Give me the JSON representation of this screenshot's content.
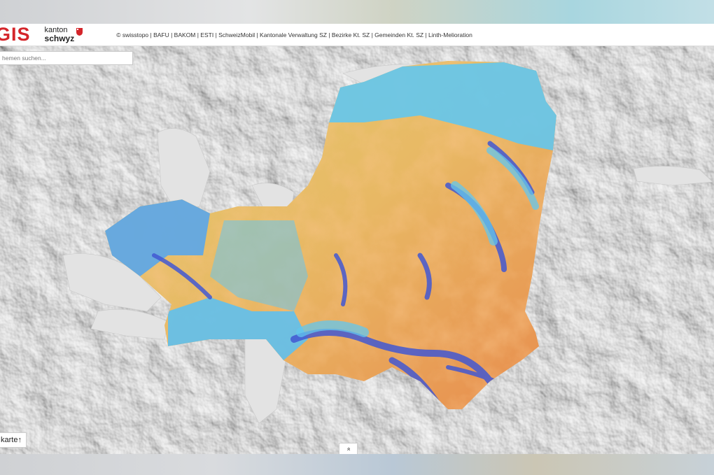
{
  "header": {
    "logo_text": "GIS",
    "kanton_line1": "kanton",
    "kanton_line2": "schwyz",
    "attribution": "© swisstopo | BAFU | BAKOM | ESTI | SchweizMobil | Kantonale Verwaltung SZ | Bezirke Kt. SZ | Gemeinden Kt. SZ | Linth-Melioration"
  },
  "search": {
    "placeholder": "hemen suchen..."
  },
  "controls": {
    "basemap_label": "karte",
    "basemap_arrow": "↑",
    "expand_glyph": "»"
  },
  "colors": {
    "brand_red": "#d4252a",
    "overlay_low": "#e8c96a",
    "overlay_mid": "#e89a52",
    "overlay_high": "#4f73d9",
    "overlay_water": "#63c7ee"
  },
  "icons": {
    "shield": "schwyz-shield-icon",
    "basemap": "arrow-up-icon",
    "expand": "double-chevron-up-icon"
  }
}
